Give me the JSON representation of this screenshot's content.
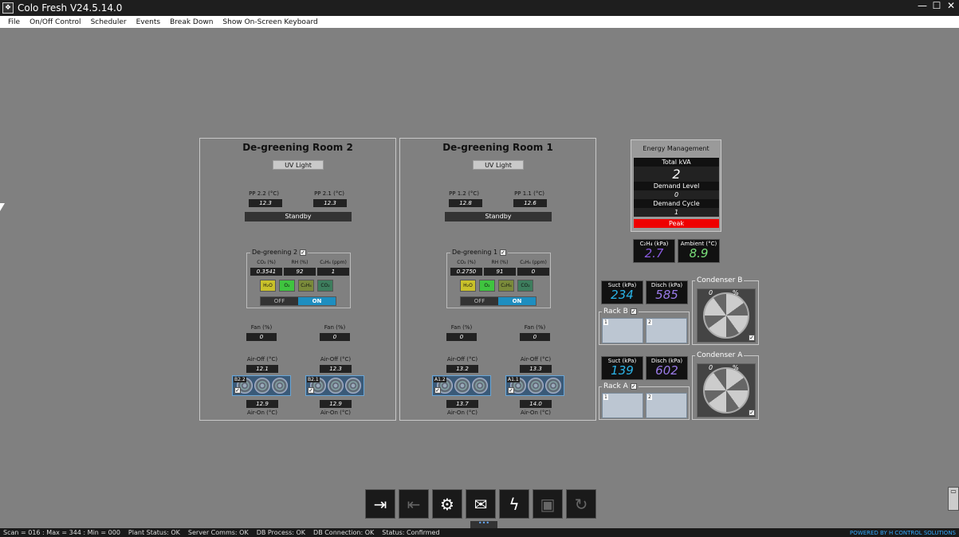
{
  "titlebar": {
    "title": "Colo Fresh V24.5.14.0",
    "min": "—",
    "max": "☐",
    "close": "✕"
  },
  "menu": [
    "File",
    "On/Off Control",
    "Scheduler",
    "Events",
    "Break Down",
    "Show On-Screen Keyboard"
  ],
  "rooms": [
    {
      "title": "De-greening Room 2",
      "uv": "UV Light",
      "pp_left_label": "PP 2.2 (°C)",
      "pp_left_value": "12.3",
      "pp_right_label": "PP 2.1 (°C)",
      "pp_right_value": "12.3",
      "status": "Standby",
      "degreen_label": "De-greening 2",
      "co2_label": "CO₂ (%)",
      "co2_value": "0.3541",
      "rh_label": "RH (%)",
      "rh_value": "92",
      "c2h4_label": "C₂H₄ (ppm)",
      "c2h4_value": "1",
      "gas": [
        "H₂O",
        "O₂",
        "C₂H₄",
        "CO₂"
      ],
      "off": "OFF",
      "on": "ON",
      "fan_left_label": "Fan (%)",
      "fan_left_value": "0",
      "fan_right_label": "Fan (%)",
      "fan_right_value": "0",
      "airoff_left_label": "Air-Off (°C)",
      "airoff_left_value": "12.1",
      "airoff_right_label": "Air-Off (°C)",
      "airoff_right_value": "12.3",
      "coil_left_tag": "B2.2",
      "coil_right_tag": "B2.1",
      "airon_left_value": "12.9",
      "airon_right_value": "12.9",
      "airon_left_label": "Air-On (°C)",
      "airon_right_label": "Air-On (°C)"
    },
    {
      "title": "De-greening Room 1",
      "uv": "UV Light",
      "pp_left_label": "PP 1.2 (°C)",
      "pp_left_value": "12.8",
      "pp_right_label": "PP 1.1 (°C)",
      "pp_right_value": "12.6",
      "status": "Standby",
      "degreen_label": "De-greening 1",
      "co2_label": "CO₂ (%)",
      "co2_value": "0.2750",
      "rh_label": "RH (%)",
      "rh_value": "91",
      "c2h4_label": "C₂H₄ (ppm)",
      "c2h4_value": "0",
      "gas": [
        "H₂O",
        "O₂",
        "C₂H₄",
        "CO₂"
      ],
      "off": "OFF",
      "on": "ON",
      "fan_left_label": "Fan (%)",
      "fan_left_value": "0",
      "fan_right_label": "Fan (%)",
      "fan_right_value": "0",
      "airoff_left_label": "Air-Off (°C)",
      "airoff_left_value": "13.2",
      "airoff_right_label": "Air-Off (°C)",
      "airoff_right_value": "13.3",
      "coil_left_tag": "A1.2",
      "coil_right_tag": "A1.1",
      "airon_left_value": "13.7",
      "airon_right_value": "14.0",
      "airon_left_label": "Air-On (°C)",
      "airon_right_label": "Air-On (°C)"
    }
  ],
  "energy": {
    "title": "Energy Management",
    "total_label": "Total kVA",
    "total_value": "2",
    "demand_level_label": "Demand Level",
    "demand_level_value": "0",
    "demand_cycle_label": "Demand Cycle",
    "demand_cycle_value": "1",
    "peak": "Peak"
  },
  "ambient": {
    "c2h4_label": "C₂H₄ (kPa)",
    "c2h4_value": "2.7",
    "ambient_label": "Ambient (°C)",
    "ambient_value": "8.9"
  },
  "rack_b": {
    "suct_label": "Suct (kPa)",
    "suct_value": "234",
    "disch_label": "Disch (kPa)",
    "disch_value": "585",
    "title": "Rack B",
    "comp1": "1",
    "comp2": "2",
    "condenser_title": "Condenser B",
    "condenser_pct": "0",
    "condenser_unit": "%"
  },
  "rack_a": {
    "suct_label": "Suct (kPa)",
    "suct_value": "139",
    "disch_label": "Disch (kPa)",
    "disch_value": "602",
    "title": "Rack A",
    "comp1": "1",
    "comp2": "2",
    "condenser_title": "Condenser A",
    "condenser_pct": "0",
    "condenser_unit": "%"
  },
  "colors": {
    "suct": "#2ab4e8",
    "disch": "#9a7ae8",
    "c2h4": "#8a5ae0",
    "ambient": "#7ae07a",
    "peak": "#e00000",
    "on": "#1e8ec0"
  },
  "icons": [
    "login-icon",
    "logout-icon",
    "user-settings-icon",
    "mail-icon",
    "lightning-icon",
    "save-icon",
    "refresh-icon"
  ],
  "grip": "•••",
  "status": {
    "scan": "Scan = 016 : Max = 344 : Min = 000",
    "plant": "Plant Status: OK",
    "server": "Server Comms: OK",
    "dbp": "DB Process: OK",
    "dbc": "DB Connection: OK",
    "st": "Status: Confirmed",
    "powered": "POWERED BY H CONTROL SOLUTIONS"
  }
}
